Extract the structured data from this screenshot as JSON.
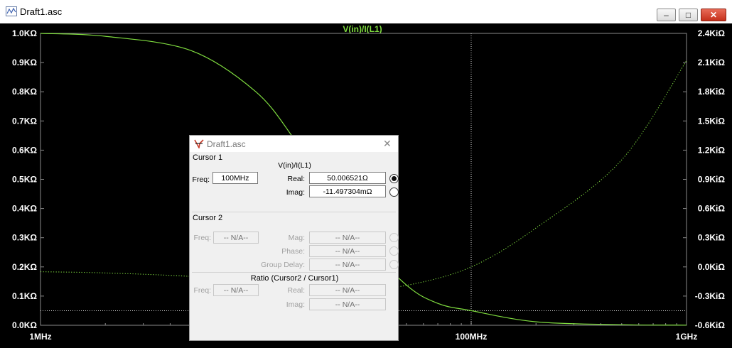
{
  "window": {
    "title": "Draft1.asc",
    "controls": {
      "minimize": "–",
      "maximize": "□",
      "close": "✕"
    }
  },
  "colors": {
    "plot_bg": "#000000",
    "trace": "#7fdc3f",
    "axis_text": "#ffffff",
    "titlebar_close": "#c5301b"
  },
  "chart_data": {
    "type": "line",
    "title": "V(in)/I(L1)",
    "xscale": "log",
    "xlim": [
      1000000,
      1000000000
    ],
    "x_ticks": [
      "1MHz",
      "10MHz",
      "100MHz",
      "1GHz"
    ],
    "y_left_ticks": [
      "0.0KΩ",
      "0.1KΩ",
      "0.2KΩ",
      "0.3KΩ",
      "0.4KΩ",
      "0.5KΩ",
      "0.6KΩ",
      "0.7KΩ",
      "0.8KΩ",
      "0.9KΩ",
      "1.0KΩ"
    ],
    "y_left_lim": [
      0,
      1000
    ],
    "y_right_ticks": [
      "-0.6KiΩ",
      "-0.3KiΩ",
      "0.0KiΩ",
      "0.3KiΩ",
      "0.6KiΩ",
      "0.9KiΩ",
      "1.2KiΩ",
      "1.5KiΩ",
      "1.8KiΩ",
      "2.1KiΩ",
      "2.4KiΩ"
    ],
    "y_right_lim": [
      -600,
      2400
    ],
    "series": [
      {
        "role": "real",
        "style": "solid",
        "axis": "left",
        "x": [
          1000000,
          2000000,
          5000000,
          10000000,
          15000000,
          20000000,
          30000000,
          50000000,
          70000000,
          100000000,
          200000000,
          500000000,
          1000000000
        ],
        "values": [
          1000,
          990,
          941,
          800,
          640,
          500,
          308,
          138,
          75,
          50,
          12,
          2,
          0.5
        ]
      },
      {
        "role": "imaginary",
        "style": "dotted",
        "axis": "right",
        "x": [
          1000000,
          2000000,
          5000000,
          10000000,
          20000000,
          30000000,
          50000000,
          100000000,
          200000000,
          500000000,
          1000000000
        ],
        "values": [
          -50,
          -62,
          -98,
          -150,
          -210,
          -230,
          -190,
          0,
          400,
          1100,
          2120
        ]
      }
    ],
    "markers": {
      "cursor_x": 100000000,
      "reference_y_left": 50
    },
    "grid": false
  },
  "dialog": {
    "title": "Draft1.asc",
    "close": "✕",
    "cursor1": {
      "header": "Cursor 1",
      "trace_name": "V(in)/I(L1)",
      "freq_label": "Freq:",
      "freq_value": "100MHz",
      "real_label": "Real:",
      "real_value": "50.006521Ω",
      "imag_label": "Imag:",
      "imag_value": "-11.497304mΩ"
    },
    "cursor2": {
      "header": "Cursor 2",
      "freq_label": "Freq:",
      "freq_value": "-- N/A--",
      "mag_label": "Mag:",
      "mag_value": "-- N/A--",
      "phase_label": "Phase:",
      "phase_value": "-- N/A--",
      "group_delay_label": "Group Delay:",
      "group_delay_value": "-- N/A--"
    },
    "ratio": {
      "header": "Ratio (Cursor2 / Cursor1)",
      "freq_label": "Freq:",
      "freq_value": "-- N/A--",
      "real_label": "Real:",
      "real_value": "-- N/A--",
      "imag_label": "Imag:",
      "imag_value": "-- N/A--"
    }
  }
}
